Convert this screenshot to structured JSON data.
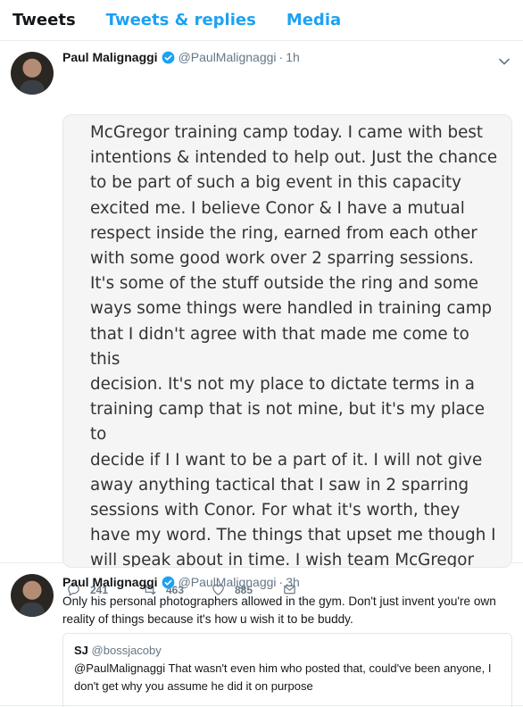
{
  "tabs": [
    {
      "label": "Tweets"
    },
    {
      "label": "Tweets & replies"
    },
    {
      "label": "Media"
    }
  ],
  "tweet1": {
    "name": "Paul Malignaggi",
    "handle": "@PaulMalignaggi",
    "dot": "·",
    "time": "1h",
    "image_text": "McGregor training camp today. I came with best\nintentions & intended to help out. Just the chance\nto be part of such a big event in this capacity\nexcited me. I believe Conor & I have a mutual\nrespect inside the ring, earned from each other\nwith some good work over 2 sparring sessions.\nIt's some of the stuff outside the ring and some\nways some things were handled in training camp\nthat I didn't agree with that made me come to this\ndecision. It's not my place to dictate terms in a\ntraining camp that is not mine, but it's my place to\ndecide if I I want to be a part of it. I will not give\naway anything tactical that I saw in 2 sparring\nsessions with Conor. For what it's worth, they\nhave my word. The things that upset me though I\nwill speak about in time. I wish team McGregor\nwell in the rest of their preparations and look\nforward to being back in Vegas to work fight week",
    "replies": "241",
    "retweets": "463",
    "likes": "885"
  },
  "tweet2": {
    "name": "Paul Malignaggi",
    "handle": "@PaulMalignaggi",
    "dot": "·",
    "time": "3h",
    "text": "Only his personal photographers allowed in the gym.  Don't just invent you're own reality of things because it's how u wish it to be buddy.",
    "quote": {
      "name": "SJ",
      "handle": "@bossjacoby",
      "text": "@PaulMalignaggi That wasn't even him who posted that, could've been anyone, I don't get why you assume he did it on purpose"
    }
  },
  "colors": {
    "accent": "#1da1f2",
    "muted": "#657786",
    "border": "#e6ecf0"
  },
  "icons": [
    "verified-icon",
    "chevron-down-icon",
    "reply-icon",
    "retweet-icon",
    "like-icon",
    "direct-message-icon"
  ]
}
